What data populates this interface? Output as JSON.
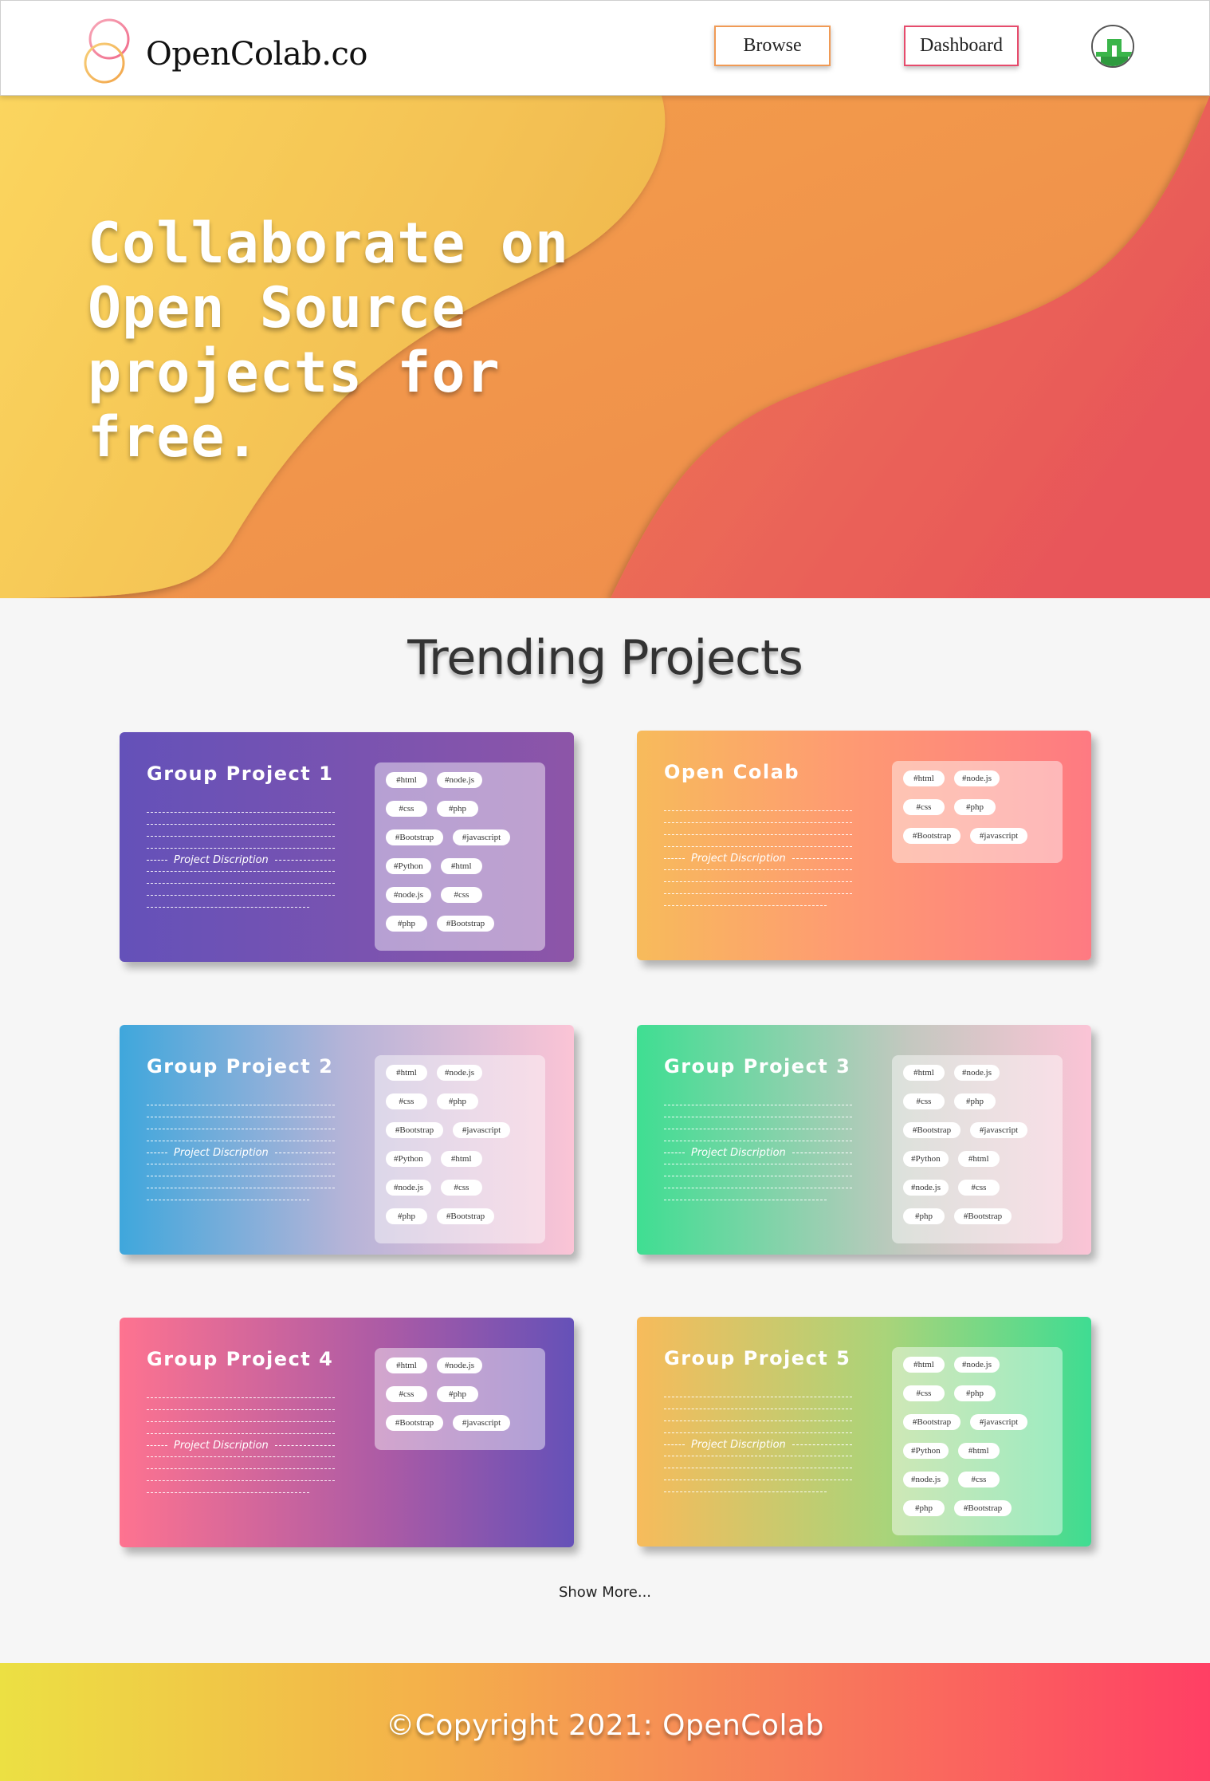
{
  "header": {
    "brand": "OpenColab.co",
    "nav": {
      "browse": "Browse",
      "dashboard": "Dashboard"
    }
  },
  "hero": {
    "title": "Collaborate on Open Source projects for free."
  },
  "trending": {
    "title": "Trending Projects",
    "description_label": "Project Discription",
    "projects": [
      {
        "title": "Group Project 1",
        "tags": [
          "#html",
          "#node.js",
          "#css",
          "#php",
          "#Bootstrap",
          "#javascript",
          "#Python",
          "#html",
          "#node.js",
          "#css",
          "#php",
          "#Bootstrap"
        ]
      },
      {
        "title": "Open Colab",
        "tags": [
          "#html",
          "#node.js",
          "#css",
          "#php",
          "#Bootstrap",
          "#javascript"
        ]
      },
      {
        "title": "Group Project 2",
        "tags": [
          "#html",
          "#node.js",
          "#css",
          "#php",
          "#Bootstrap",
          "#javascript",
          "#Python",
          "#html",
          "#node.js",
          "#css",
          "#php",
          "#Bootstrap"
        ]
      },
      {
        "title": "Group Project 3",
        "tags": [
          "#html",
          "#node.js",
          "#css",
          "#php",
          "#Bootstrap",
          "#javascript",
          "#Python",
          "#html",
          "#node.js",
          "#css",
          "#php",
          "#Bootstrap"
        ]
      },
      {
        "title": "Group Project 4",
        "tags": [
          "#html",
          "#node.js",
          "#css",
          "#php",
          "#Bootstrap",
          "#javascript"
        ]
      },
      {
        "title": "Group Project 5",
        "tags": [
          "#html",
          "#node.js",
          "#css",
          "#php",
          "#Bootstrap",
          "#javascript",
          "#Python",
          "#html",
          "#node.js",
          "#css",
          "#php",
          "#Bootstrap"
        ]
      }
    ],
    "show_more": "Show More..."
  },
  "footer": {
    "copyright": "©Copyright 2021: OpenColab"
  },
  "colors": {
    "hero_yellow": "#f8d05c",
    "hero_orange": "#f29a4c",
    "hero_red": "#e9595b",
    "browse_border": "#f09a55",
    "dashboard_border": "#e64b6c"
  }
}
